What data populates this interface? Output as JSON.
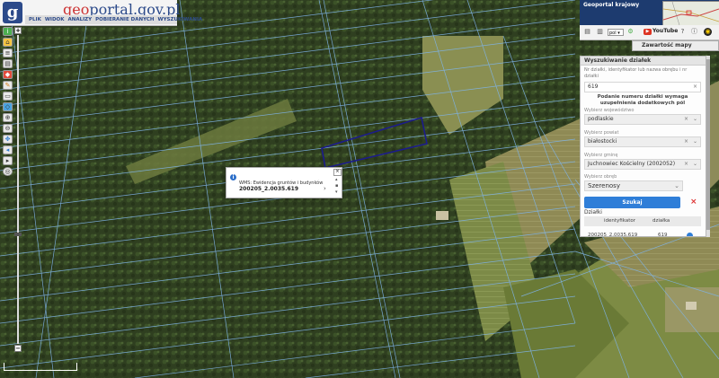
{
  "app": {
    "logo_letter": "g",
    "logo_text_prefix": "geo",
    "logo_text_suffix": "portal.gov.pl"
  },
  "menu": [
    "PLIK",
    "WIDOK",
    "ANALIZY",
    "POBIERANIE DANYCH",
    "WYSZUKIWANIA"
  ],
  "toolbar_icons": [
    "info-icon",
    "home-icon",
    "layers-icon",
    "print-icon",
    "measure-icon",
    "draw-icon",
    "ruler-icon",
    "area-icon",
    "zoom-in-icon",
    "zoom-out-icon",
    "pan-icon",
    "back-icon",
    "forward-icon",
    "full-extent-icon"
  ],
  "popup": {
    "layer": "WMS: Ewidencja gruntów i budynków",
    "value": "200205_2.0035.619"
  },
  "ribbon": {
    "title": "Geoportal krajowy"
  },
  "top_controls": {
    "language": "pol",
    "youtube": "YouTube"
  },
  "contents_button": "Zawartość mapy",
  "search_panel": {
    "title": "Wyszukiwanie działek",
    "description": "Nr działki, identyfikator lub nazwa obrębu i nr działki",
    "query": "619",
    "warning": "Podanie numeru działki wymaga uzupełnienia dodatkowych pól",
    "voivodeship_label": "Wybierz województwo",
    "voivodeship": "podlaskie",
    "county_label": "Wybierz powiat",
    "county": "białostocki",
    "commune_label": "Wybierz gminę",
    "commune": "Juchnowiec Kościelny (2002052)",
    "precinct_label": "Wybierz obręb",
    "precinct": "Szerenosy",
    "search_button": "Szukaj",
    "results_label": "Działki",
    "col_id": "identyfikator",
    "col_parcel": "działka",
    "result_id": "200205_2.0035.619",
    "result_parcel": "619"
  },
  "colors": {
    "parcel_outline": "#1c1c8c",
    "boundary_lines": "#7fb3e6",
    "brand_blue": "#2c4a8a"
  }
}
